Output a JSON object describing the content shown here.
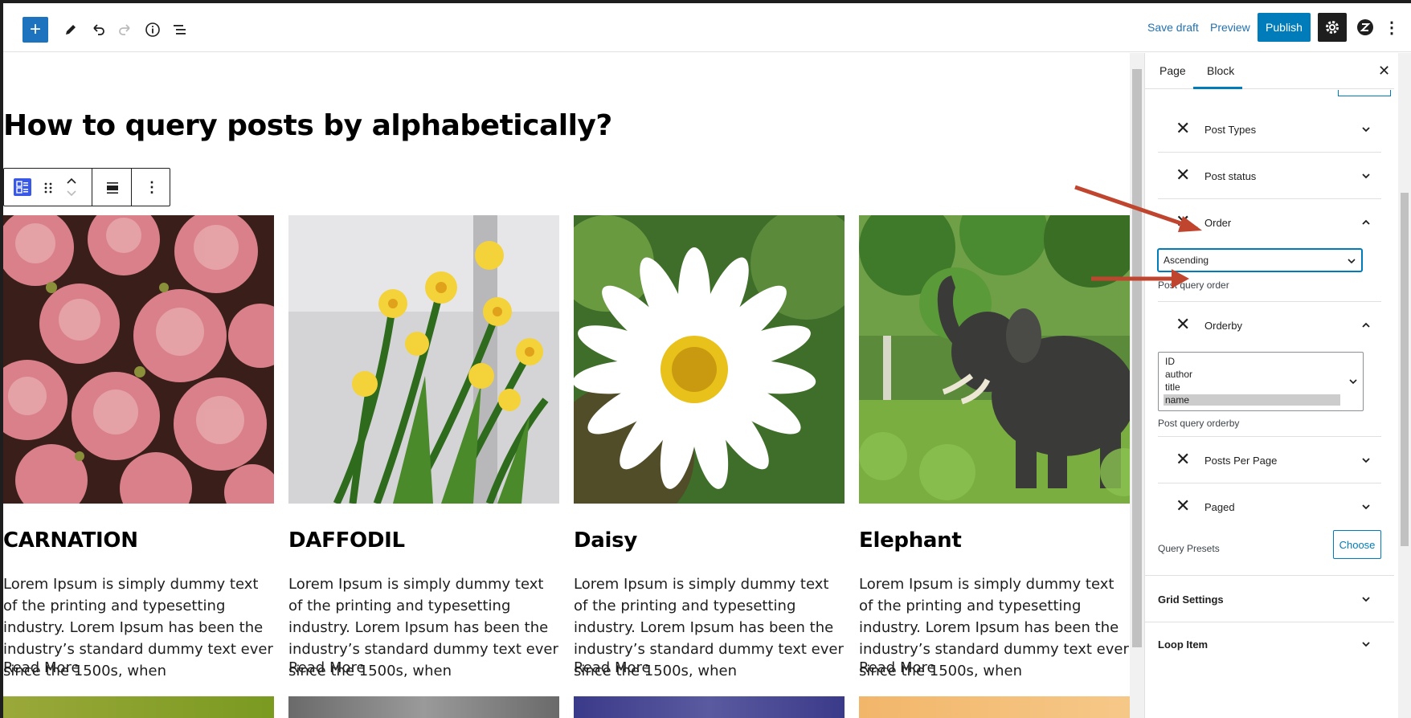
{
  "toolbar": {
    "add_label": "+",
    "save_draft_label": "Save draft",
    "preview_label": "Preview",
    "publish_label": "Publish"
  },
  "editor": {
    "title": "How to query posts by alphabetically?",
    "posts": [
      {
        "title": "CARNATION",
        "excerpt": "Lorem Ipsum is simply dummy text of the printing and typesetting industry. Lorem Ipsum has been the industry’s standard dummy text ever since the 1500s, when",
        "read_more": "Read More"
      },
      {
        "title": "DAFFODIL",
        "excerpt": "Lorem Ipsum is simply dummy text of the printing and typesetting industry. Lorem Ipsum has been the industry’s standard dummy text ever since the 1500s, when",
        "read_more": "Read More"
      },
      {
        "title": "Daisy",
        "excerpt": "Lorem Ipsum is simply dummy text of the printing and typesetting industry. Lorem Ipsum has been the industry’s standard dummy text ever since the 1500s, when",
        "read_more": "Read More"
      },
      {
        "title": "Elephant",
        "excerpt": "Lorem Ipsum is simply dummy text of the printing and typesetting industry. Lorem Ipsum has been the industry’s standard dummy text ever since the 1500s, when",
        "read_more": "Read More"
      }
    ]
  },
  "sidebar": {
    "tabs": [
      "Page",
      "Block"
    ],
    "active_tab": "Block",
    "sections": {
      "post_types": "Post Types",
      "post_status": "Post status",
      "order": "Order",
      "order_value": "Ascending",
      "order_help": "Post query order",
      "orderby": "Orderby",
      "orderby_options": [
        "ID",
        "author",
        "title",
        "name"
      ],
      "orderby_selected": "name",
      "orderby_help": "Post query orderby",
      "posts_per_page": "Posts Per Page",
      "paged": "Paged",
      "query_presets": "Query Presets",
      "choose_label": "Choose",
      "grid_settings": "Grid Settings",
      "loop_item": "Loop Item"
    }
  },
  "colors": {
    "accent": "#007cba",
    "arrow": "#c0452f"
  }
}
